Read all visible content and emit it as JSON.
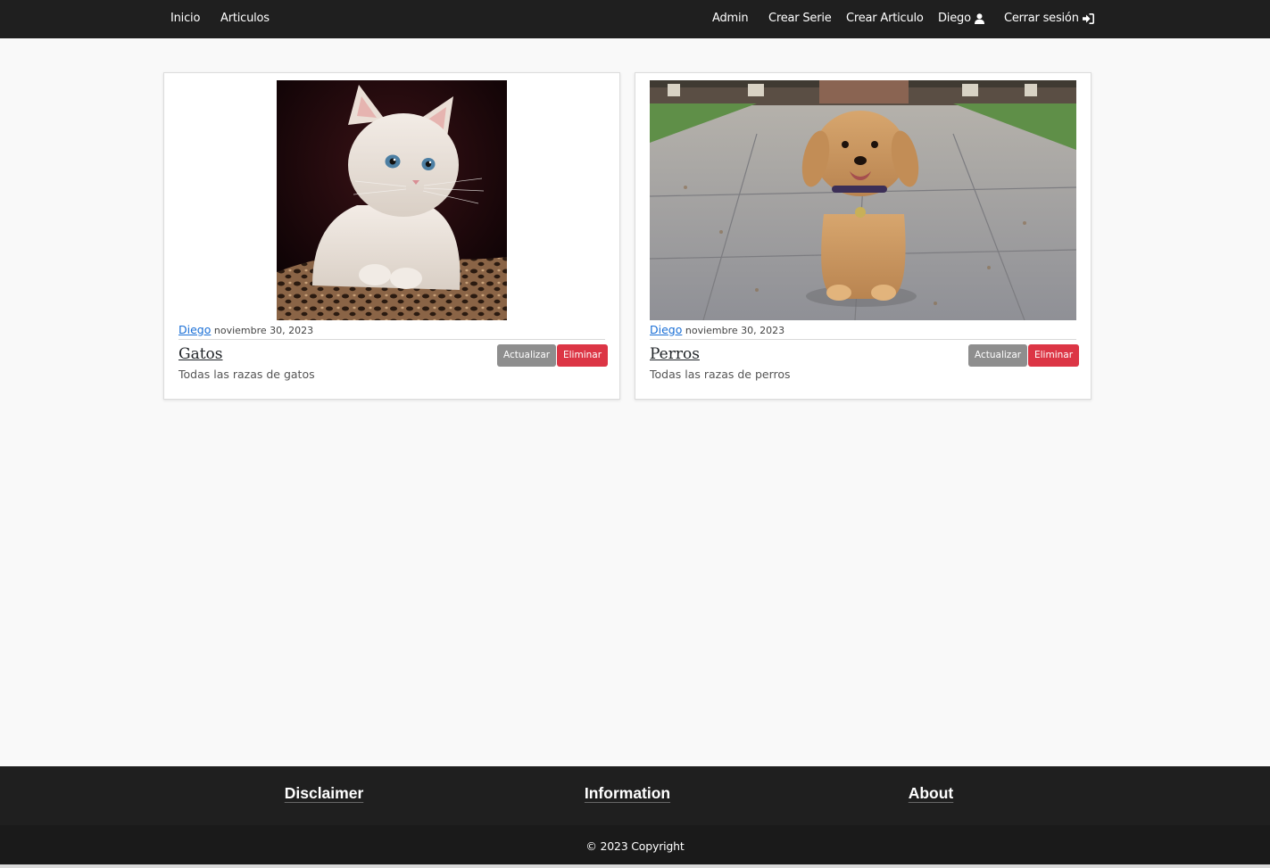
{
  "nav": {
    "left": [
      {
        "label": "Inicio"
      },
      {
        "label": "Articulos"
      }
    ],
    "right": [
      {
        "label": "Admin"
      },
      {
        "label": "Crear Serie"
      },
      {
        "label": "Crear Articulo"
      },
      {
        "label": "Diego",
        "icon": "user-icon"
      },
      {
        "label": "Cerrar sesión",
        "icon": "sign-in-icon"
      }
    ]
  },
  "articles": [
    {
      "image": "kitten-photo",
      "author": "Diego",
      "date": "noviembre 30, 2023",
      "title": "Gatos",
      "description": "Todas las razas de gatos",
      "update_label": "Actualizar",
      "delete_label": "Eliminar"
    },
    {
      "image": "puppy-photo",
      "author": "Diego",
      "date": "noviembre 30, 2023",
      "title": "Perros",
      "description": "Todas las razas de perros",
      "update_label": "Actualizar",
      "delete_label": "Eliminar"
    }
  ],
  "footer": {
    "headings": [
      "Disclaimer",
      "Information",
      "About"
    ],
    "copyright": "© 2023 Copyright"
  },
  "colors": {
    "navbar": "#1f1f1f",
    "page_bg": "#f9f9f9",
    "link": "#1a6fd6",
    "update_button": "#8e8e8e",
    "delete_button": "#dc3545"
  }
}
